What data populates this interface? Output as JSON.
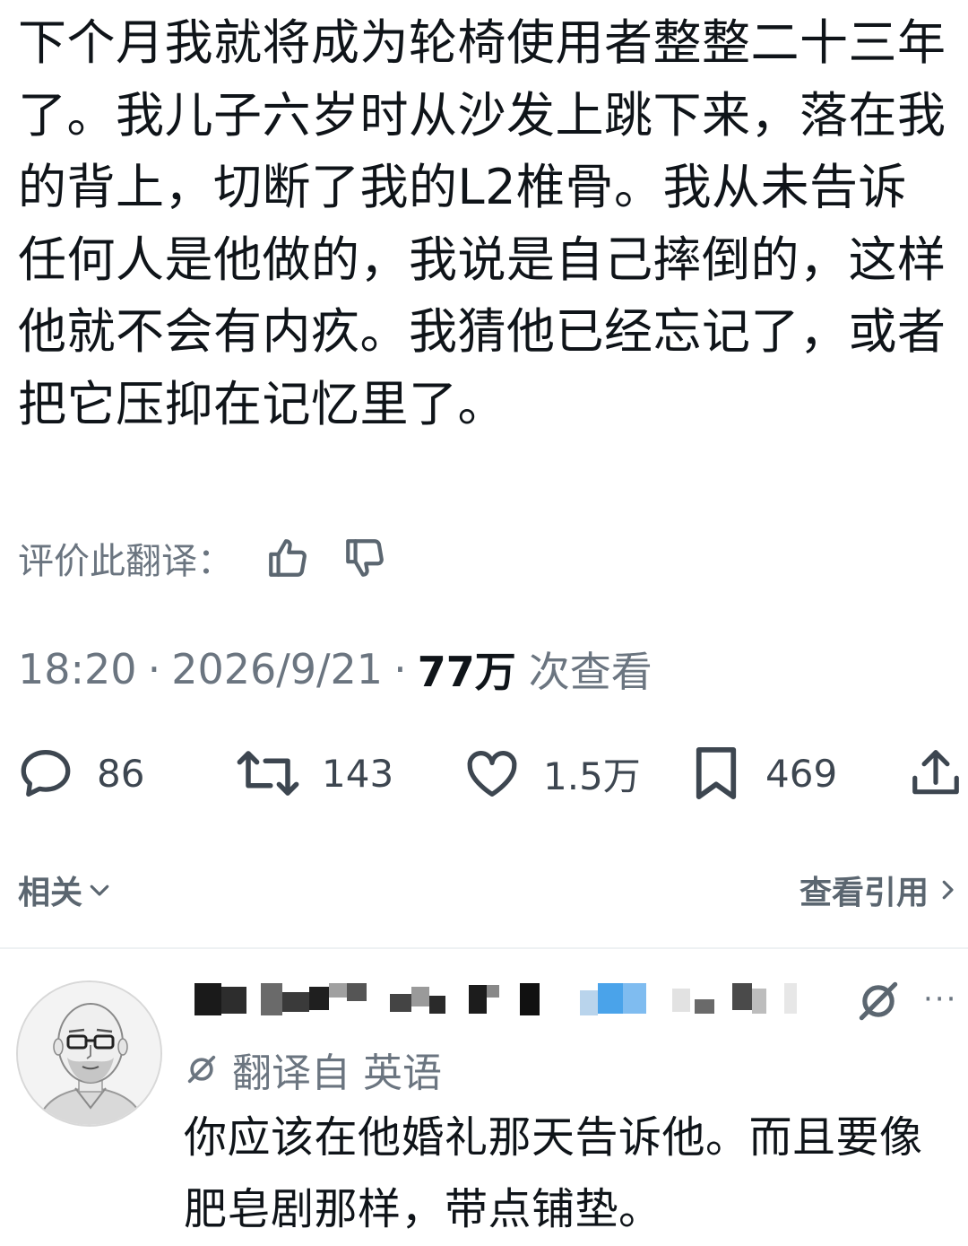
{
  "tweet": {
    "text": "下个月我就将成为轮椅使用者整整二十三年了。我儿子六岁时从沙发上跳下来，落在我的背上，切断了我的L2椎骨。我从未告诉任何人是他做的，我说是自己摔倒的，这样他就不会有内疚。我猜他已经忘记了，或者把它压抑在记忆里了。"
  },
  "rate_translation": {
    "label": "评价此翻译：",
    "thumbs_up_icon": "thumbs-up-icon",
    "thumbs_down_icon": "thumbs-down-icon"
  },
  "meta": {
    "time": "18:20",
    "separator": "·",
    "date": "2026/9/21",
    "views_count": "77万",
    "views_label": "次查看"
  },
  "actions": {
    "replies": {
      "icon": "reply-bubble-icon",
      "count": "86"
    },
    "retweets": {
      "icon": "retweet-icon",
      "count": "143"
    },
    "likes": {
      "icon": "heart-icon",
      "count": "1.5万"
    },
    "bookmarks": {
      "icon": "bookmark-icon",
      "count": "469"
    },
    "share": {
      "icon": "share-icon"
    }
  },
  "related": {
    "left_label": "相关",
    "right_label": "查看引用"
  },
  "reply": {
    "translated_from": "翻译自 英语",
    "text": "你应该在他婚礼那天告诉他。而且要像肥皂剧那样，带点铺垫。",
    "more_icon": "more-dots-icon",
    "grok_icon": "grok-icon"
  },
  "colors": {
    "text_primary": "#0f1419",
    "text_secondary": "#6b7580",
    "divider": "#eef1f3"
  }
}
